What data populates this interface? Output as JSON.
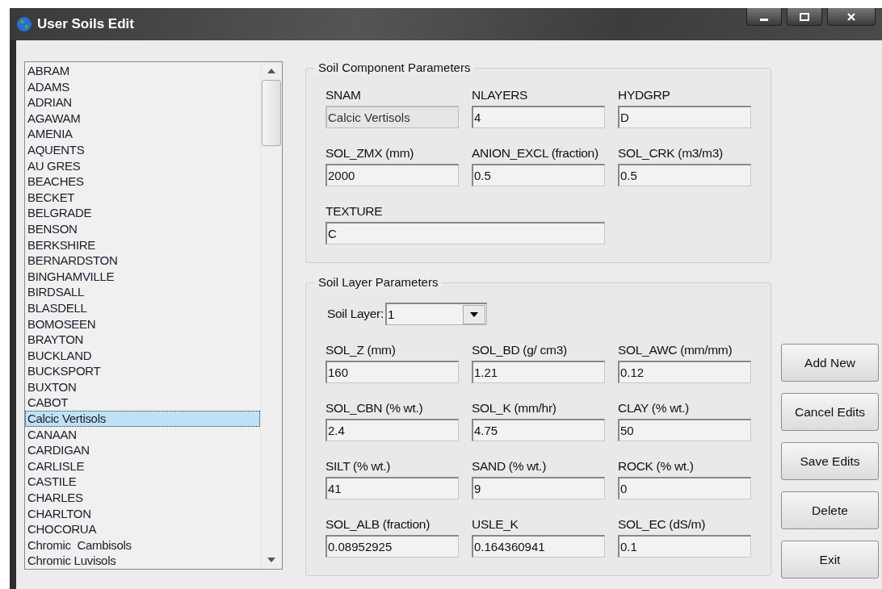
{
  "window": {
    "title": "User Soils Edit"
  },
  "soil_list": {
    "items": [
      {
        "label": "ABRAM",
        "selected": false
      },
      {
        "label": "ADAMS",
        "selected": false
      },
      {
        "label": "ADRIAN",
        "selected": false
      },
      {
        "label": "AGAWAM",
        "selected": false
      },
      {
        "label": "AMENIA",
        "selected": false
      },
      {
        "label": "AQUENTS",
        "selected": false
      },
      {
        "label": "AU GRES",
        "selected": false
      },
      {
        "label": "BEACHES",
        "selected": false
      },
      {
        "label": "BECKET",
        "selected": false
      },
      {
        "label": "BELGRADE",
        "selected": false
      },
      {
        "label": "BENSON",
        "selected": false
      },
      {
        "label": "BERKSHIRE",
        "selected": false
      },
      {
        "label": "BERNARDSTON",
        "selected": false
      },
      {
        "label": "BINGHAMVILLE",
        "selected": false
      },
      {
        "label": "BIRDSALL",
        "selected": false
      },
      {
        "label": "BLASDELL",
        "selected": false
      },
      {
        "label": "BOMOSEEN",
        "selected": false
      },
      {
        "label": "BRAYTON",
        "selected": false
      },
      {
        "label": "BUCKLAND",
        "selected": false
      },
      {
        "label": "BUCKSPORT",
        "selected": false
      },
      {
        "label": "BUXTON",
        "selected": false
      },
      {
        "label": "CABOT",
        "selected": false
      },
      {
        "label": "Calcic Vertisols",
        "selected": true
      },
      {
        "label": "CANAAN",
        "selected": false
      },
      {
        "label": "CARDIGAN",
        "selected": false
      },
      {
        "label": "CARLISLE",
        "selected": false
      },
      {
        "label": "CASTILE",
        "selected": false
      },
      {
        "label": "CHARLES",
        "selected": false
      },
      {
        "label": "CHARLTON",
        "selected": false
      },
      {
        "label": "CHOCORUA",
        "selected": false
      },
      {
        "label": "Chromic  Cambisols",
        "selected": false
      },
      {
        "label": "Chromic Luvisols",
        "selected": false
      }
    ]
  },
  "component_group": {
    "title": "Soil Component Parameters",
    "fields": [
      {
        "label": "SNAM",
        "value": "Calcic Vertisols",
        "disabled": true
      },
      {
        "label": "NLAYERS",
        "value": "4",
        "disabled": false
      },
      {
        "label": "HYDGRP",
        "value": "D",
        "disabled": false
      },
      {
        "label": "SOL_ZMX (mm)",
        "value": "2000",
        "disabled": false
      },
      {
        "label": "ANION_EXCL (fraction)",
        "value": "0.5",
        "disabled": false
      },
      {
        "label": "SOL_CRK (m3/m3)",
        "value": "0.5",
        "disabled": false
      },
      {
        "label": "TEXTURE",
        "value": "C",
        "disabled": false,
        "wide": true
      }
    ]
  },
  "layer_group": {
    "title": "Soil Layer Parameters",
    "layer_select": {
      "label": "Soil Layer:",
      "value": "1"
    },
    "fields": [
      {
        "label": "SOL_Z (mm)",
        "value": "160",
        "disabled": false
      },
      {
        "label": "SOL_BD (g/ cm3)",
        "value": "1.21",
        "disabled": false
      },
      {
        "label": "SOL_AWC (mm/mm)",
        "value": "0.12",
        "disabled": false
      },
      {
        "label": "SOL_CBN (% wt.)",
        "value": "2.4",
        "disabled": false
      },
      {
        "label": "SOL_K (mm/hr)",
        "value": "4.75",
        "disabled": false
      },
      {
        "label": "CLAY (% wt.)",
        "value": "50",
        "disabled": false
      },
      {
        "label": "SILT (% wt.)",
        "value": "41",
        "disabled": false
      },
      {
        "label": "SAND (% wt.)",
        "value": "9",
        "disabled": false
      },
      {
        "label": "ROCK (% wt.)",
        "value": "0",
        "disabled": false
      },
      {
        "label": "SOL_ALB (fraction)",
        "value": "0.08952925",
        "disabled": false
      },
      {
        "label": "USLE_K",
        "value": "0.164360941",
        "disabled": false
      },
      {
        "label": "SOL_EC (dS/m)",
        "value": "0.1",
        "disabled": false
      }
    ]
  },
  "buttons": [
    "Add New",
    "Cancel Edits",
    "Save Edits",
    "Delete",
    "Exit"
  ]
}
